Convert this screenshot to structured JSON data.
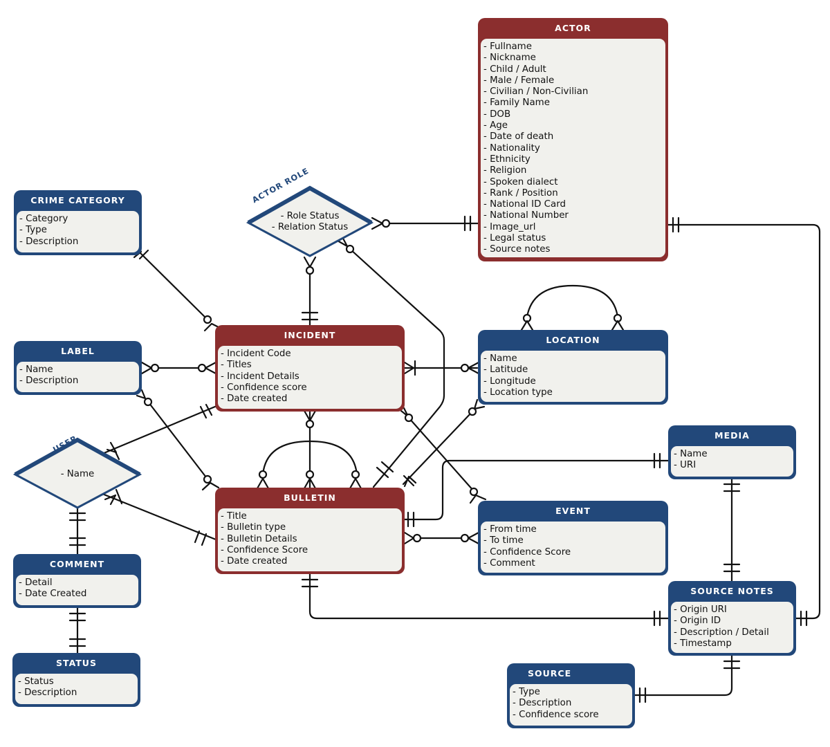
{
  "diagram": {
    "type": "entity-relationship",
    "colors": {
      "core_entity": "#8b2e2e",
      "entity": "#22487a",
      "entity_body": "#f1f1ed",
      "line": "#111111"
    },
    "entities": {
      "actor": {
        "title": "ACTOR",
        "fields": [
          "- Fullname",
          "- Nickname",
          "- Child / Adult",
          "- Male / Female",
          "- Civilian / Non-Civilian",
          "- Family Name",
          "- DOB",
          "- Age",
          "- Date of death",
          "- Nationality",
          "- Ethnicity",
          "- Religion",
          "- Spoken dialect",
          "- Rank / Position",
          "- National ID Card",
          "- National Number",
          "- Image_url",
          "- Legal status",
          "- Source notes"
        ]
      },
      "crime_category": {
        "title": "CRIME CATEGORY",
        "fields": [
          "- Category",
          "- Type",
          "- Description"
        ]
      },
      "label": {
        "title": "LABEL",
        "fields": [
          "- Name",
          "- Description"
        ]
      },
      "incident": {
        "title": "INCIDENT",
        "fields": [
          "- Incident Code",
          "- Titles",
          "- Incident Details",
          "- Confidence score",
          "- Date created"
        ]
      },
      "location": {
        "title": "LOCATION",
        "fields": [
          "- Name",
          "- Latitude",
          "- Longitude",
          "- Location type"
        ]
      },
      "media": {
        "title": "MEDIA",
        "fields": [
          "- Name",
          "- URI"
        ]
      },
      "bulletin": {
        "title": "BULLETIN",
        "fields": [
          "- Title",
          "- Bulletin type",
          "- Bulletin Details",
          "- Confidence Score",
          "- Date created"
        ]
      },
      "event": {
        "title": "EVENT",
        "fields": [
          "- From time",
          "- To time",
          "- Confidence Score",
          "- Comment"
        ]
      },
      "comment": {
        "title": "COMMENT",
        "fields": [
          "- Detail",
          "- Date Created"
        ]
      },
      "status": {
        "title": "STATUS",
        "fields": [
          "- Status",
          "- Description"
        ]
      },
      "source_notes": {
        "title": "SOURCE NOTES",
        "fields": [
          "- Origin URI",
          "- Origin ID",
          "- Description / Detail",
          "- Timestamp"
        ]
      },
      "source": {
        "title": "SOURCE",
        "fields": [
          "- Type",
          "- Description",
          "- Confidence score"
        ]
      }
    },
    "relationships": {
      "actor_role": {
        "title": "ACTOR ROLE",
        "fields": [
          "- Role Status",
          "- Relation Status"
        ]
      },
      "user": {
        "title": "USER",
        "fields": [
          "- Name"
        ]
      }
    },
    "links": [
      {
        "from": "actor_role",
        "to": "actor",
        "from_end": "zero-or-many",
        "to_end": "exactly-one"
      },
      {
        "from": "actor_role",
        "to": "incident",
        "from_end": "zero-or-many",
        "to_end": "exactly-one"
      },
      {
        "from": "actor_role",
        "to": "bulletin",
        "from_end": "zero-or-many",
        "to_end": "exactly-one"
      },
      {
        "from": "crime_category",
        "to": "incident",
        "from_end": "one-or-many",
        "to_end": "zero-or-many"
      },
      {
        "from": "label",
        "to": "incident",
        "from_end": "zero-or-many",
        "to_end": "zero-or-many"
      },
      {
        "from": "label",
        "to": "bulletin",
        "from_end": "zero-or-many",
        "to_end": "zero-or-many"
      },
      {
        "from": "incident",
        "to": "location",
        "from_end": "one-or-many",
        "to_end": "zero-or-many"
      },
      {
        "from": "incident",
        "to": "bulletin",
        "from_end": "zero-or-many",
        "to_end": "zero-or-many"
      },
      {
        "from": "incident",
        "to": "event",
        "from_end": "zero-or-many",
        "to_end": "zero-or-many"
      },
      {
        "from": "user",
        "to": "incident",
        "from_end": "one-or-many",
        "to_end": "exactly-one"
      },
      {
        "from": "user",
        "to": "bulletin",
        "from_end": "one-or-many",
        "to_end": "exactly-one"
      },
      {
        "from": "user",
        "to": "comment",
        "from_end": "exactly-one",
        "to_end": "exactly-one"
      },
      {
        "from": "comment",
        "to": "status",
        "from_end": "exactly-one",
        "to_end": "exactly-one"
      },
      {
        "from": "bulletin",
        "to": "bulletin",
        "from_end": "zero-or-many",
        "to_end": "zero-or-many"
      },
      {
        "from": "bulletin",
        "to": "location",
        "from_end": "one-or-many",
        "to_end": "zero-or-many"
      },
      {
        "from": "bulletin",
        "to": "media",
        "from_end": "exactly-one",
        "to_end": "exactly-one"
      },
      {
        "from": "bulletin",
        "to": "event",
        "from_end": "zero-or-many",
        "to_end": "zero-or-many"
      },
      {
        "from": "bulletin",
        "to": "source_notes",
        "from_end": "exactly-one",
        "to_end": "exactly-one"
      },
      {
        "from": "location",
        "to": "location",
        "from_end": "zero-or-many",
        "to_end": "zero-or-many"
      },
      {
        "from": "media",
        "to": "source_notes",
        "from_end": "exactly-one",
        "to_end": "exactly-one"
      },
      {
        "from": "actor",
        "to": "source_notes",
        "from_end": "exactly-one",
        "to_end": "exactly-one"
      },
      {
        "from": "source",
        "to": "source_notes",
        "from_end": "exactly-one",
        "to_end": "exactly-one"
      }
    ]
  }
}
